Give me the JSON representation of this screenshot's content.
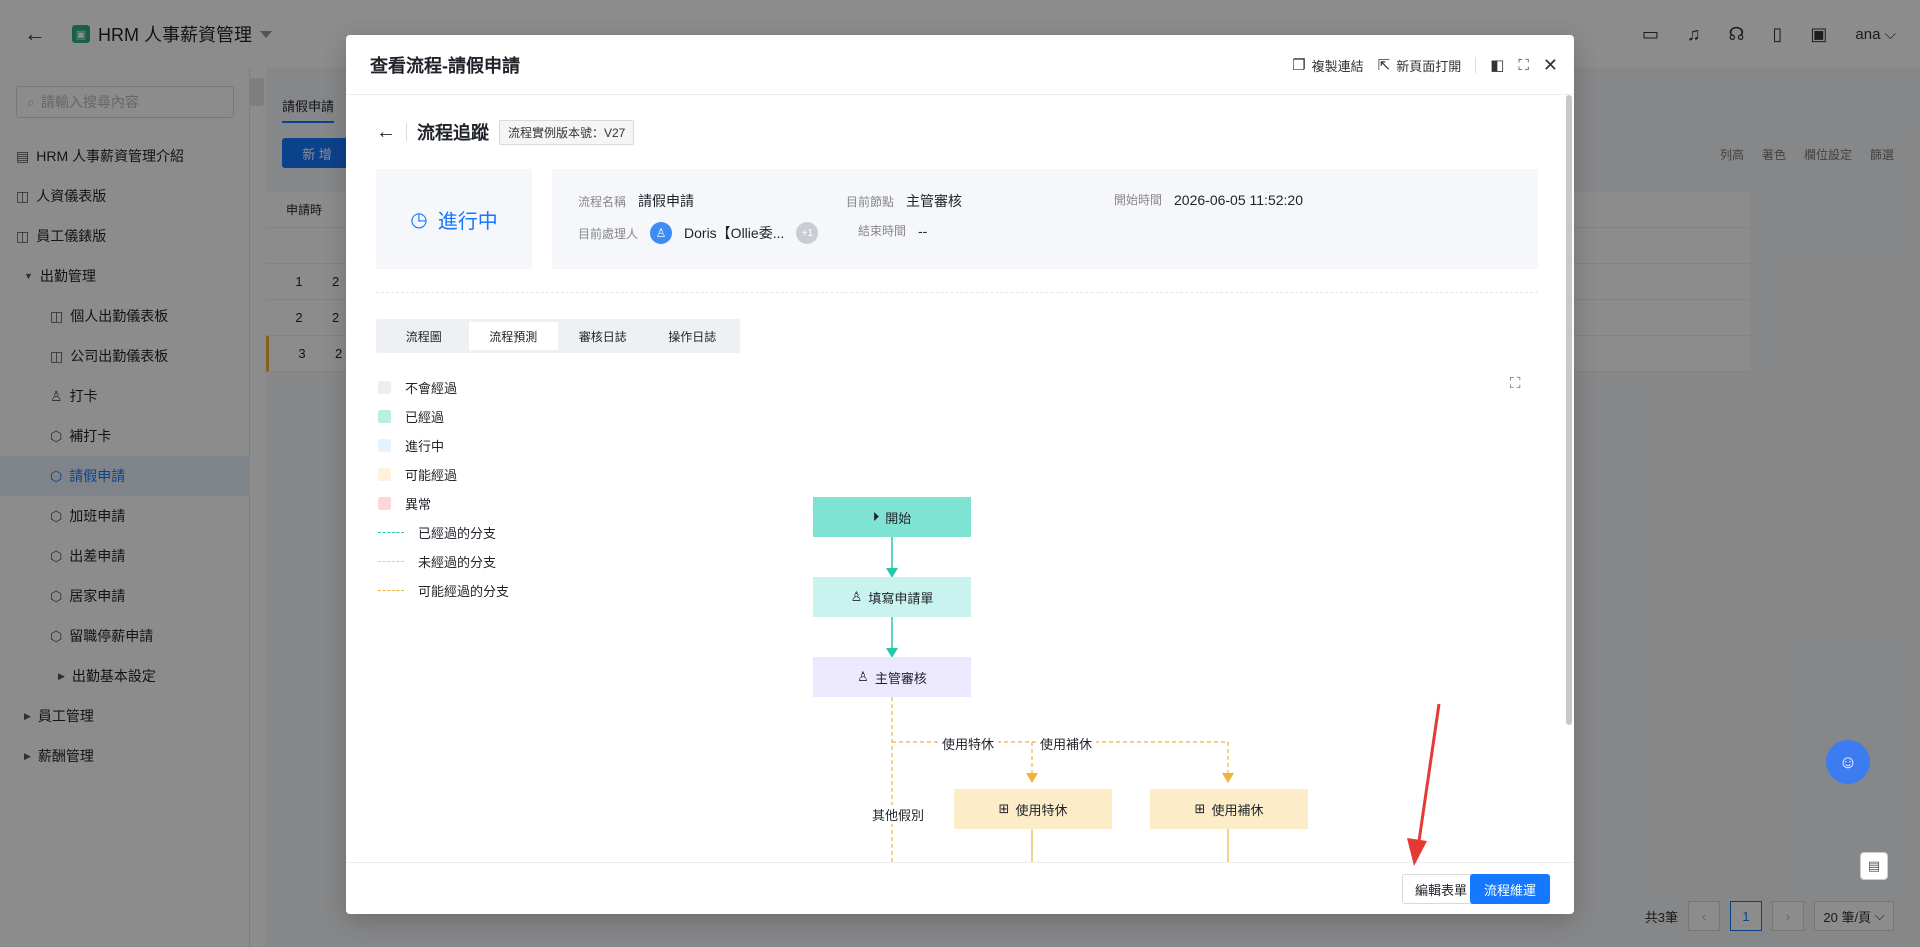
{
  "app": {
    "title": "HRM 人事薪資管理",
    "user": "ana"
  },
  "sidebar": {
    "search_placeholder": "請輸入搜尋內容",
    "items": [
      {
        "label": "HRM 人事薪資管理介紹",
        "icon": "table-icon"
      },
      {
        "label": "人資儀表版",
        "icon": "dashboard-icon"
      },
      {
        "label": "員工儀錶版",
        "icon": "dashboard-icon"
      },
      {
        "label": "出勤管理",
        "icon": "caret-down-icon"
      },
      {
        "label": "個人出勤儀表板",
        "icon": "dashboard-icon"
      },
      {
        "label": "公司出勤儀表板",
        "icon": "dashboard-icon"
      },
      {
        "label": "打卡",
        "icon": "user-icon"
      },
      {
        "label": "補打卡",
        "icon": "cube-icon"
      },
      {
        "label": "請假申請",
        "icon": "cube-icon"
      },
      {
        "label": "加班申請",
        "icon": "cube-icon"
      },
      {
        "label": "出差申請",
        "icon": "cube-icon"
      },
      {
        "label": "居家申請",
        "icon": "cube-icon"
      },
      {
        "label": "留職停薪申請",
        "icon": "cube-icon"
      },
      {
        "label": "出勤基本設定",
        "icon": "caret-right-icon"
      },
      {
        "label": "員工管理",
        "icon": "caret-right-icon"
      },
      {
        "label": "薪酬管理",
        "icon": "caret-right-icon"
      }
    ]
  },
  "main": {
    "tab": "請假申請",
    "add_label": "新 增",
    "filter_chip": "申請時",
    "toolbar": [
      "列高",
      "著色",
      "欄位設定",
      "篩選"
    ],
    "rows": [
      {
        "idx": "1",
        "c1": "2"
      },
      {
        "idx": "2",
        "c1": "2"
      },
      {
        "idx": "3",
        "c1": "2"
      }
    ],
    "pager": {
      "total": "共3筆",
      "page": "1",
      "size": "20 筆/頁"
    }
  },
  "modal": {
    "title": "查看流程-請假申請",
    "actions": {
      "copy": "複製連結",
      "newpage": "新頁面打開"
    },
    "trace_title": "流程追蹤",
    "version": "流程實例版本號：V27",
    "status": "進行中",
    "info": {
      "name_label": "流程名稱",
      "name_value": "請假申請",
      "node_label": "目前節點",
      "node_value": "主管審核",
      "start_label": "開始時間",
      "start_value": "2026-06-05 11:52:20",
      "handler_label": "目前處理人",
      "handler_value": "Doris【Ollie委...",
      "handler_extra": "+1",
      "end_label": "結束時間",
      "end_value": "--"
    },
    "tabs": [
      "流程圖",
      "流程預測",
      "審核日誌",
      "操作日誌"
    ],
    "legend": [
      {
        "label": "不會經過",
        "color": "#eeeeee",
        "kind": "swatch"
      },
      {
        "label": "已經過",
        "color": "#b9efe4",
        "kind": "swatch"
      },
      {
        "label": "進行中",
        "color": "#e6f3ff",
        "kind": "swatch"
      },
      {
        "label": "可能經過",
        "color": "#fff1dc",
        "kind": "swatch"
      },
      {
        "label": "異常",
        "color": "#ffd6d6",
        "kind": "swatch"
      },
      {
        "label": "已經過的分支",
        "color": "#28c9a8",
        "kind": "line"
      },
      {
        "label": "未經過的分支",
        "color": "#cccccc",
        "kind": "line"
      },
      {
        "label": "可能經過的分支",
        "color": "#f0b23a",
        "kind": "line"
      }
    ],
    "flow": {
      "start": "開始",
      "fill": "填寫申請單",
      "review": "主管審核",
      "branch1": "使用特休",
      "branch2": "使用補休",
      "branch_other": "其他假別",
      "node_special": "使用特休",
      "node_comp": "使用補休"
    },
    "footer": {
      "edit": "編輯表單",
      "go": "流程維運"
    }
  },
  "colors": {
    "accent": "#1677ff",
    "passed": "#28c9a8",
    "possible": "#f0b23a",
    "annotation": "#e53935"
  }
}
